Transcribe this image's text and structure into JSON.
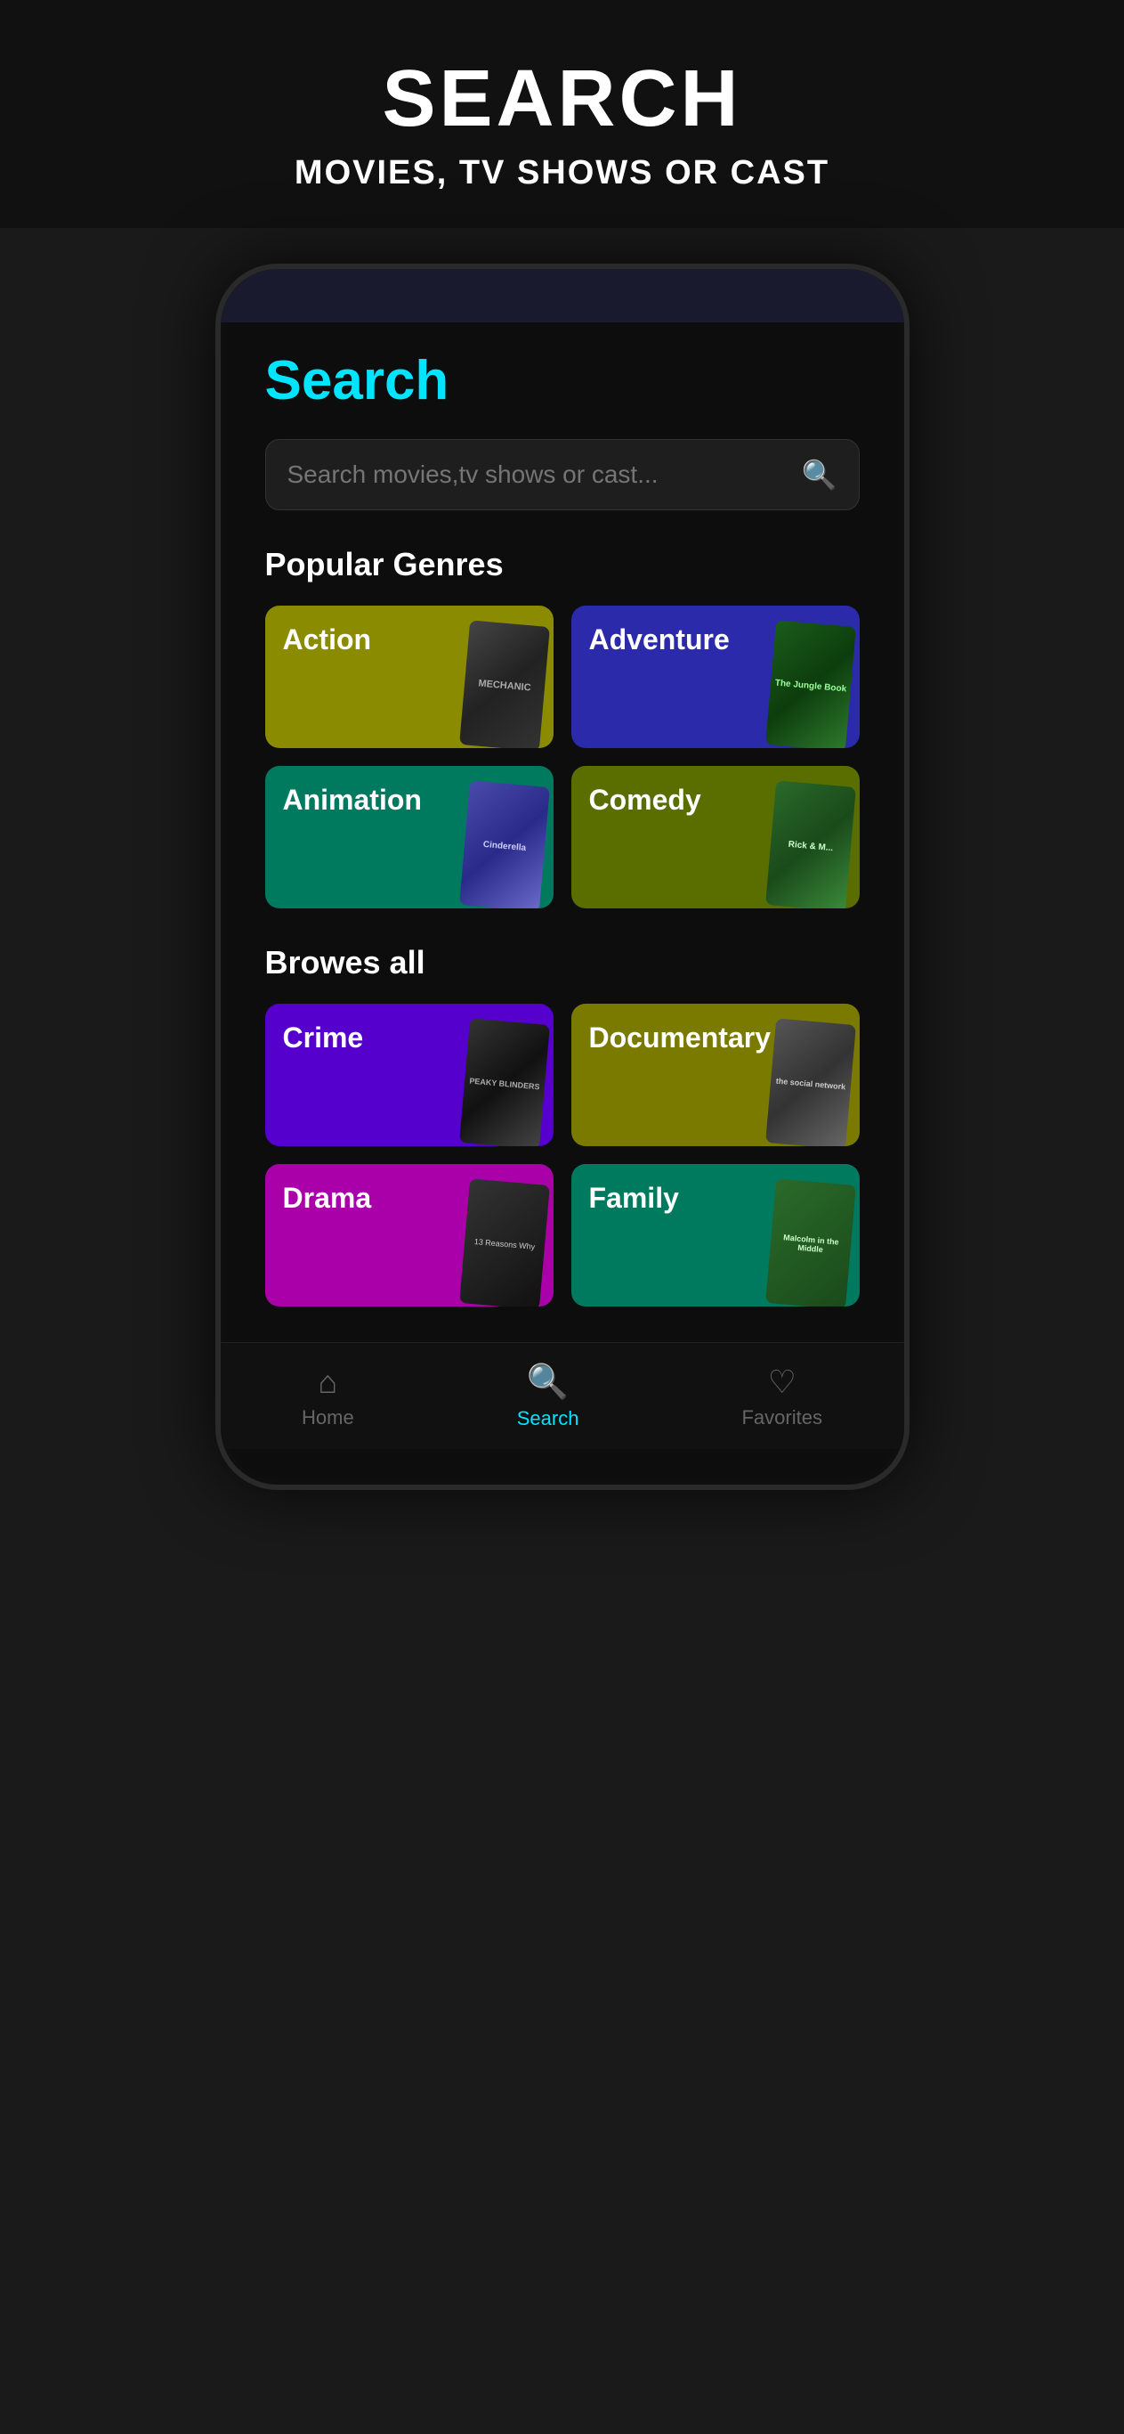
{
  "header": {
    "title": "SEARCH",
    "subtitle": "MOVIES, TV SHOWS OR CAST"
  },
  "search": {
    "page_title": "Search",
    "input_placeholder": "Search movies,tv shows or cast..."
  },
  "popular_genres": {
    "section_title": "Popular Genres",
    "genres": [
      {
        "id": "action",
        "label": "Action",
        "color": "action",
        "poster": "mechanic"
      },
      {
        "id": "adventure",
        "label": "Adventure",
        "color": "adventure",
        "poster": "jungle"
      },
      {
        "id": "animation",
        "label": "Animation",
        "color": "animation",
        "poster": "cinderella"
      },
      {
        "id": "comedy",
        "label": "Comedy",
        "color": "comedy",
        "poster": "rickmorty"
      }
    ]
  },
  "browse_all": {
    "section_title": "Browes all",
    "genres": [
      {
        "id": "crime",
        "label": "Crime",
        "color": "crime",
        "poster": "peaky"
      },
      {
        "id": "documentary",
        "label": "Documentary",
        "color": "documentary",
        "poster": "social"
      },
      {
        "id": "drama",
        "label": "Drama",
        "color": "drama",
        "poster": "drama2"
      },
      {
        "id": "family",
        "label": "Family",
        "color": "family",
        "poster": "malcolm"
      }
    ]
  },
  "bottom_nav": {
    "items": [
      {
        "id": "home",
        "label": "Home",
        "icon": "🏠",
        "active": false
      },
      {
        "id": "search",
        "label": "Search",
        "icon": "🔍",
        "active": true
      },
      {
        "id": "favorites",
        "label": "Favorites",
        "icon": "♡",
        "active": false
      }
    ]
  }
}
